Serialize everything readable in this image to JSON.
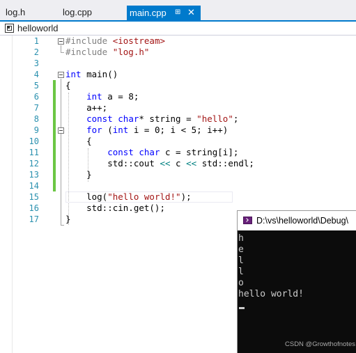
{
  "tabs": [
    {
      "label": "log.h"
    },
    {
      "label": "log.cpp"
    },
    {
      "label": "main.cpp",
      "active": true
    }
  ],
  "tab_pin_icon": "pin-icon",
  "tab_close_icon": "close-icon",
  "navbar": {
    "scope_label": "helloworld",
    "icon": "project-scope-icon"
  },
  "editor": {
    "line_numbers": [
      "1",
      "2",
      "3",
      "4",
      "5",
      "6",
      "7",
      "8",
      "9",
      "10",
      "11",
      "12",
      "13",
      "14",
      "15",
      "16",
      "17"
    ]
  },
  "colors": {
    "accent": "#007acc",
    "keyword": "#0000ff",
    "string": "#a31515",
    "line_number": "#2b91af",
    "change_bar": "#6cc644"
  },
  "console": {
    "title": "D:\\vs\\helloworld\\Debug\\",
    "icon": "console-app-icon",
    "lines": [
      "h",
      "e",
      "l",
      "l",
      "o",
      "hello world!"
    ],
    "watermark": "CSDN @Growthofnotes"
  }
}
